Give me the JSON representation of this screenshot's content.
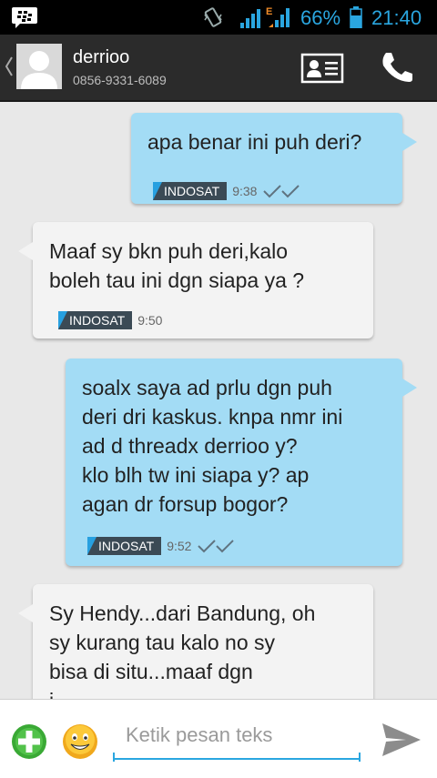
{
  "status_bar": {
    "network_type": "E",
    "battery_percent": "66%",
    "time": "21:40"
  },
  "header": {
    "contact_name": "derrioo",
    "contact_number": "0856-9331-6089"
  },
  "messages": [
    {
      "direction": "outgoing",
      "text": "apa benar ini puh deri?",
      "carrier": "INDOSAT",
      "time": "9:38"
    },
    {
      "direction": "incoming",
      "text": "Maaf sy bkn puh deri,kalo\nboleh tau ini dgn siapa ya ?",
      "carrier": "INDOSAT",
      "time": "9:50"
    },
    {
      "direction": "outgoing",
      "text": "soalx saya ad prlu dgn puh\nderi dri kaskus. knpa nmr ini\nad d threadx derrioo y?\nklo blh tw ini siapa y? ap\nagan dr forsup bogor?",
      "carrier": "INDOSAT",
      "time": "9:52"
    },
    {
      "direction": "incoming",
      "text": "Sy Hendy...dari Bandung, oh\nsy kurang tau kalo no sy\nbisa di situ...maaf dgn\ni",
      "carrier": "",
      "time": ""
    }
  ],
  "input": {
    "placeholder": "Ketik pesan teks"
  },
  "colors": {
    "accent": "#2aa6e0",
    "outgoing_bubble": "#a3dcf5",
    "incoming_bubble": "#f3f3f3",
    "header_bg": "#2b2b2b"
  },
  "icons": {
    "bbm": "bbm-icon",
    "vibrate": "vibrate-icon",
    "signal": "signal-icon",
    "battery": "battery-icon",
    "back": "chevron-left-icon",
    "avatar": "person-icon",
    "contact_card": "contact-card-icon",
    "call": "phone-icon",
    "add": "plus-icon",
    "emoji": "smiley-icon",
    "send": "send-icon"
  }
}
